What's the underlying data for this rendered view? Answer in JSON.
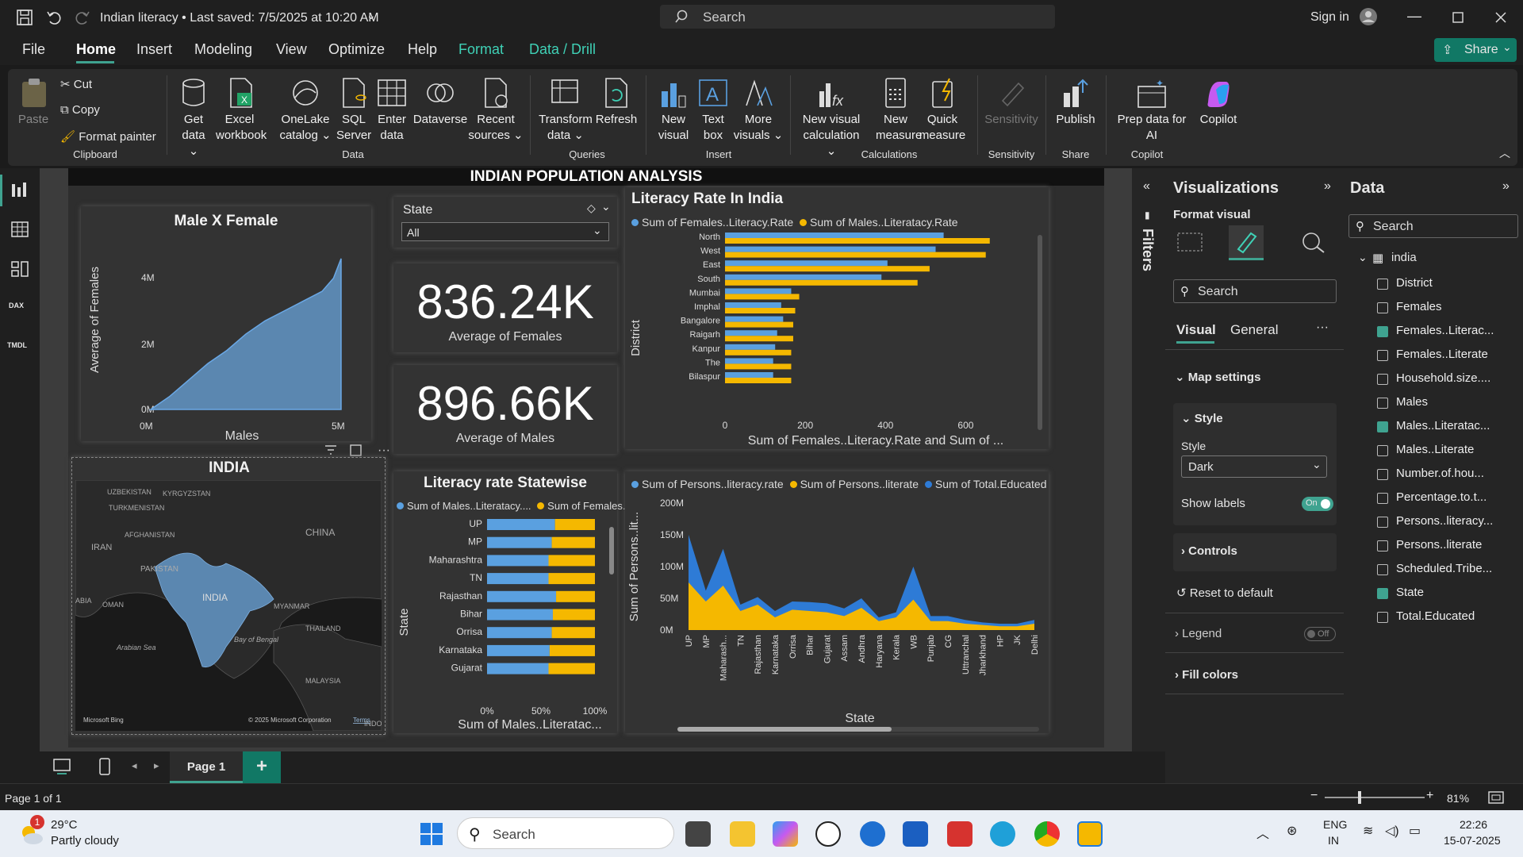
{
  "titlebar": {
    "doc_title": "Indian literacy • Last saved: 7/5/2025 at 10:20 AM",
    "search": "Search",
    "signin": "Sign in"
  },
  "menu": {
    "file": "File",
    "home": "Home",
    "insert": "Insert",
    "modeling": "Modeling",
    "view": "View",
    "optimize": "Optimize",
    "help": "Help",
    "format": "Format",
    "data_drill": "Data / Drill",
    "share": "Share"
  },
  "ribbon": {
    "paste": "Paste",
    "cut": "Cut",
    "copy": "Copy",
    "format_painter": "Format painter",
    "clipboard": "Clipboard",
    "get_data": "Get data",
    "excel": "Excel workbook",
    "onelake": "OneLake catalog",
    "sql": "SQL Server",
    "enter": "Enter data",
    "dataverse": "Dataverse",
    "recent": "Recent sources",
    "data": "Data",
    "transform": "Transform data",
    "refresh": "Refresh",
    "queries": "Queries",
    "new_visual": "New visual",
    "text_box": "Text box",
    "more_visuals": "More visuals",
    "insert": "Insert",
    "new_calc": "New visual calculation",
    "new_measure": "New measure",
    "quick_measure": "Quick measure",
    "calculations": "Calculations",
    "sensitivity": "Sensitivity",
    "sensitivity_grp": "Sensitivity",
    "publish": "Publish",
    "share_grp": "Share",
    "prep": "Prep data for AI",
    "copilot": "Copilot",
    "copilot_grp": "Copilot"
  },
  "report": {
    "title": "INDIAN POPULATION ANALYSIS",
    "area": {
      "title": "Male X Female",
      "ylabel": "Average of Females",
      "xlabel": "Males",
      "yticks": [
        "4M",
        "2M",
        "0M"
      ],
      "xticks": [
        "0M",
        "5M"
      ]
    },
    "slicer": {
      "label": "State",
      "value": "All"
    },
    "card1": {
      "value": "836.24K",
      "label": "Average of Females"
    },
    "card2": {
      "value": "896.66K",
      "label": "Average of Males"
    },
    "map": {
      "title": "INDIA",
      "credit": "Microsoft Bing",
      "copyright": "© 2025 Microsoft Corporation",
      "terms": "Terms",
      "labels": [
        "UZBEKISTAN",
        "KYRGYZSTAN",
        "TURKMENISTAN",
        "AFGHANISTAN",
        "IRAN",
        "PAKISTAN",
        "CHINA",
        "OMAN",
        "INDIA",
        "MYANMAR",
        "THAILAND",
        "Arabian Sea",
        "Bay of Bengal",
        "MALAYSIA",
        "ABIA",
        "INDO"
      ]
    }
  },
  "literacy_india": {
    "title": "Literacy Rate In India",
    "legend1": "Sum of Females..Literacy.Rate",
    "legend2": "Sum of Males..Literatacy.Rate",
    "ylabel": "District",
    "xlabel": "Sum of Females..Literacy.Rate and Sum of ..."
  },
  "literacy_state": {
    "title": "Literacy rate Statewise",
    "legend1": "Sum of Males..Literatacy....",
    "legend2": "Sum of Females.....",
    "ylabel": "State",
    "xlabel": "Sum of Males..Literatac..."
  },
  "persons_chart": {
    "legend1": "Sum of Persons..literacy.rate",
    "legend2": "Sum of Persons..literate",
    "legend3": "Sum of Total.Educated",
    "ylabel": "Sum of Persons..lit...",
    "xlabel": "State"
  },
  "chart_data": [
    {
      "type": "bar",
      "title": "Literacy Rate In India",
      "categories": [
        "North",
        "West",
        "East",
        "South",
        "Mumbai",
        "Imphal",
        "Bangalore",
        "Raigarh",
        "Kanpur",
        "The",
        "Bilaspur"
      ],
      "series": [
        {
          "name": "Sum of Females..Literacy.Rate",
          "values": [
            545,
            525,
            405,
            390,
            165,
            140,
            145,
            130,
            125,
            120,
            120
          ]
        },
        {
          "name": "Sum of Males..Literatacy.Rate",
          "values": [
            660,
            650,
            510,
            480,
            185,
            175,
            170,
            170,
            165,
            165,
            165
          ]
        }
      ],
      "xticks": [
        "0",
        "200",
        "400",
        "600"
      ],
      "xlim": [
        0,
        700
      ],
      "color1": "#5aa0e0",
      "color2": "#f5b800"
    },
    {
      "type": "bar",
      "title": "Literacy rate Statewise",
      "categories": [
        "UP",
        "MP",
        "Maharashtra",
        "TN",
        "Rajasthan",
        "Bihar",
        "Orrisa",
        "Karnataka",
        "Gujarat"
      ],
      "series": [
        {
          "name": "Sum of Males..Literatacy....",
          "values": [
            63,
            60,
            57,
            57,
            64,
            61,
            60,
            58,
            57
          ]
        },
        {
          "name": "Sum of Females.....",
          "values": [
            37,
            40,
            43,
            43,
            36,
            39,
            40,
            42,
            43
          ]
        }
      ],
      "xticks": [
        "0%",
        "50%",
        "100%"
      ],
      "xlim": [
        0,
        100
      ]
    },
    {
      "type": "area",
      "categories": [
        "UP",
        "MP",
        "Maharash...",
        "TN",
        "Rajasthan",
        "Karnataka",
        "Orrisa",
        "Bihar",
        "Gujarat",
        "Assam",
        "Andhra",
        "Haryana",
        "Kerala",
        "WB",
        "Punjab",
        "CG",
        "Uttranchal",
        "Jharkhand",
        "HP",
        "JK",
        "Delhi"
      ],
      "yticks": [
        "200M",
        "150M",
        "100M",
        "50M",
        "0M"
      ],
      "ylim": [
        0,
        200
      ],
      "series": [
        {
          "name": "Sum of Total.Educated",
          "values": [
            150,
            62,
            128,
            40,
            52,
            30,
            45,
            44,
            42,
            34,
            50,
            20,
            28,
            100,
            22,
            22,
            16,
            12,
            10,
            10,
            16
          ]
        },
        {
          "name": "Sum of Persons..literate",
          "values": [
            75,
            45,
            70,
            30,
            40,
            20,
            32,
            30,
            28,
            22,
            35,
            14,
            20,
            48,
            14,
            14,
            10,
            8,
            6,
            6,
            10
          ]
        }
      ]
    },
    {
      "type": "area",
      "title": "Male X Female",
      "xlim": [
        0,
        5
      ],
      "ylim": [
        0,
        4.5
      ],
      "x": [
        0,
        0.5,
        1,
        1.5,
        2,
        2.5,
        3,
        3.5,
        4,
        4.5,
        4.8,
        5
      ],
      "values": [
        0,
        0.4,
        0.9,
        1.4,
        1.8,
        2.3,
        2.7,
        3.0,
        3.3,
        3.6,
        4.0,
        4.6
      ]
    }
  ],
  "filters": {
    "label": "Filters"
  },
  "viz": {
    "title": "Visualizations",
    "format_visual": "Format visual",
    "search": "Search",
    "tab_visual": "Visual",
    "tab_general": "General",
    "map_settings": "Map settings",
    "style_section": "Style",
    "style_label": "Style",
    "style_value": "Dark",
    "show_labels": "Show labels",
    "on": "On",
    "controls": "Controls",
    "reset": "Reset to default",
    "legend": "Legend",
    "off": "Off",
    "fill_colors": "Fill colors"
  },
  "datapane": {
    "title": "Data",
    "search": "Search",
    "table": "india",
    "fields": [
      {
        "name": "District",
        "checked": false
      },
      {
        "name": "Females",
        "checked": false
      },
      {
        "name": "Females..Literac...",
        "checked": true
      },
      {
        "name": "Females..Literate",
        "checked": false
      },
      {
        "name": "Household.size....",
        "checked": false
      },
      {
        "name": "Males",
        "checked": false
      },
      {
        "name": "Males..Literatac...",
        "checked": true
      },
      {
        "name": "Males..Literate",
        "checked": false
      },
      {
        "name": "Number.of.hou...",
        "checked": false
      },
      {
        "name": "Percentage.to.t...",
        "checked": false
      },
      {
        "name": "Persons..literacy...",
        "checked": false
      },
      {
        "name": "Persons..literate",
        "checked": false
      },
      {
        "name": "Scheduled.Tribe...",
        "checked": false
      },
      {
        "name": "State",
        "checked": true
      },
      {
        "name": "Total.Educated",
        "checked": false
      }
    ]
  },
  "pagebar": {
    "page": "Page 1",
    "add": "+"
  },
  "status": {
    "page_of": "Page 1 of 1",
    "zoom": "81%"
  },
  "taskbar": {
    "temp": "29°C",
    "weather": "Partly cloudy",
    "badge": "1",
    "search": "Search",
    "lang1": "ENG",
    "lang2": "IN",
    "time": "22:26",
    "date": "15-07-2025"
  }
}
